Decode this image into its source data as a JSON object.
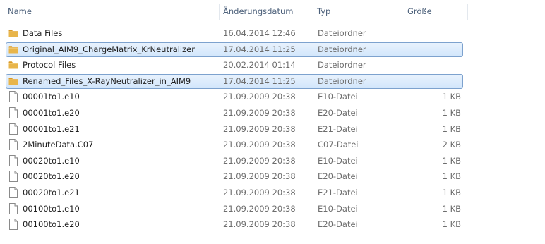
{
  "columns": {
    "name": "Name",
    "date": "Änderungsdatum",
    "type": "Typ",
    "size": "Größe"
  },
  "colors": {
    "selection_border": "#7da2ce",
    "selection_fill": "#d9eafc",
    "folder": "#e8b54a",
    "header_text": "#4c607a"
  },
  "rows": [
    {
      "kind": "folder",
      "icon": "folder-icon",
      "name": "Data Files",
      "date": "16.04.2014 12:46",
      "type": "Dateiordner",
      "size": "",
      "selected": false
    },
    {
      "kind": "folder",
      "icon": "folder-icon",
      "name": "Original_AIM9_ChargeMatrix_KrNeutralizer",
      "date": "17.04.2014 11:25",
      "type": "Dateiordner",
      "size": "",
      "selected": true
    },
    {
      "kind": "folder",
      "icon": "folder-icon",
      "name": "Protocol Files",
      "date": "20.02.2014 01:14",
      "type": "Dateiordner",
      "size": "",
      "selected": false
    },
    {
      "kind": "folder",
      "icon": "folder-icon",
      "name": "Renamed_Files_X-RayNeutralizer_in_AIM9",
      "date": "17.04.2014 11:25",
      "type": "Dateiordner",
      "size": "",
      "selected": true
    },
    {
      "kind": "file",
      "icon": "file-icon",
      "name": "00001to1.e10",
      "date": "21.09.2009 20:38",
      "type": "E10-Datei",
      "size": "1 KB",
      "selected": false
    },
    {
      "kind": "file",
      "icon": "file-icon",
      "name": "00001to1.e20",
      "date": "21.09.2009 20:38",
      "type": "E20-Datei",
      "size": "1 KB",
      "selected": false
    },
    {
      "kind": "file",
      "icon": "file-icon",
      "name": "00001to1.e21",
      "date": "21.09.2009 20:38",
      "type": "E21-Datei",
      "size": "1 KB",
      "selected": false
    },
    {
      "kind": "file",
      "icon": "file-icon",
      "name": "2MinuteData.C07",
      "date": "21.09.2009 20:38",
      "type": "C07-Datei",
      "size": "2 KB",
      "selected": false
    },
    {
      "kind": "file",
      "icon": "file-icon",
      "name": "00020to1.e10",
      "date": "21.09.2009 20:38",
      "type": "E10-Datei",
      "size": "1 KB",
      "selected": false
    },
    {
      "kind": "file",
      "icon": "file-icon",
      "name": "00020to1.e20",
      "date": "21.09.2009 20:38",
      "type": "E20-Datei",
      "size": "1 KB",
      "selected": false
    },
    {
      "kind": "file",
      "icon": "file-icon",
      "name": "00020to1.e21",
      "date": "21.09.2009 20:38",
      "type": "E21-Datei",
      "size": "1 KB",
      "selected": false
    },
    {
      "kind": "file",
      "icon": "file-icon",
      "name": "00100to1.e10",
      "date": "21.09.2009 20:38",
      "type": "E10-Datei",
      "size": "1 KB",
      "selected": false
    },
    {
      "kind": "file",
      "icon": "file-icon",
      "name": "00100to1.e20",
      "date": "21.09.2009 20:38",
      "type": "E20-Datei",
      "size": "1 KB",
      "selected": false
    }
  ]
}
